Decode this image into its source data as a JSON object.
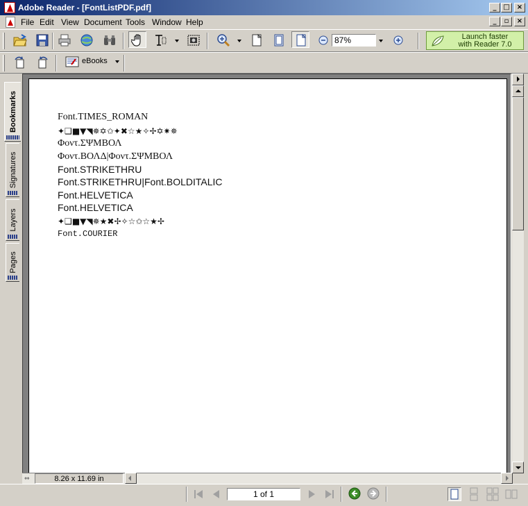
{
  "window": {
    "title": "Adobe Reader - [FontListPDF.pdf]",
    "minimize": "_",
    "maximize": "□",
    "close": "×"
  },
  "menu": {
    "items": [
      "File",
      "Edit",
      "View",
      "Document",
      "Tools",
      "Window",
      "Help"
    ]
  },
  "toolbar": {
    "zoom_value": "87%",
    "launch_text_1": "Launch faster",
    "launch_text_2": "with Reader 7.0",
    "ebooks_label": "eBooks"
  },
  "nav_tabs": [
    "Bookmarks",
    "Signatures",
    "Layers",
    "Pages"
  ],
  "document": {
    "lines": [
      "Font.TIMES_ROMAN",
      "✦❑■▼◥✵✡✩✦✖☆★✧✢✡✷✵",
      "Φοντ.ΣΨΜΒΟΛ",
      "Φοντ.ΒΟΛΔ|Φοντ.ΣΨΜΒΟΛ",
      "Font.STRIKETHRU",
      "Font.STRIKETHRU|Font.BOLDITALIC",
      "Font.HELVETICA",
      "Font.HELVETICA",
      "✦❑■▼◥✵★✖✢✧☆✩☆★✢",
      "Font.COURIER"
    ]
  },
  "status": {
    "page_size": "8.26 x 11.69 in",
    "page_indicator": "1 of 1"
  },
  "colors": {
    "title_start": "#0a246a",
    "title_end": "#a6caf0",
    "chrome": "#d4d0c8",
    "launch_bg": "#d2f0a8",
    "nav_green": "#3c8c28"
  }
}
